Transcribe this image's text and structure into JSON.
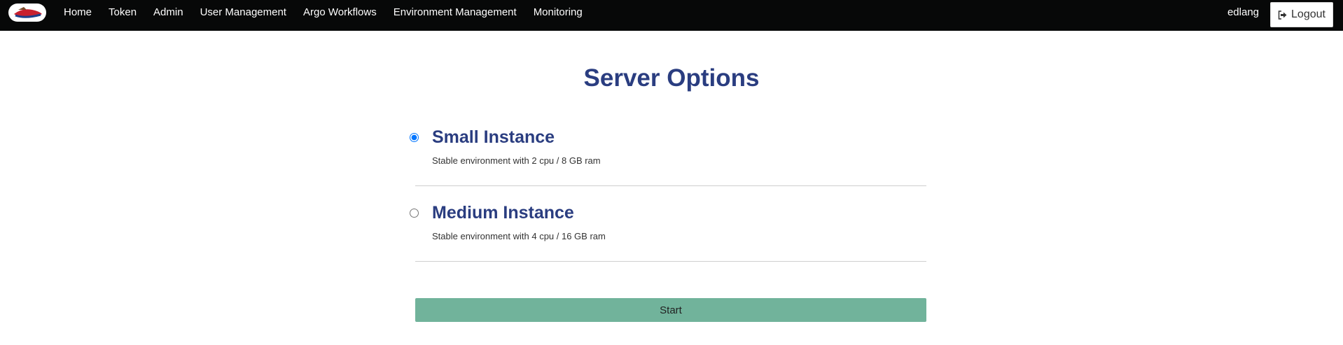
{
  "nav": {
    "logo_icon": "jupyterhub-logo-icon",
    "links": [
      "Home",
      "Token",
      "Admin",
      "User Management",
      "Argo Workflows",
      "Environment Management",
      "Monitoring"
    ],
    "username": "edlang",
    "logout_label": "Logout",
    "logout_icon": "sign-out-icon"
  },
  "page": {
    "title": "Server Options"
  },
  "options": [
    {
      "title": "Small Instance",
      "description": "Stable environment with 2 cpu / 8 GB ram",
      "selected": true
    },
    {
      "title": "Medium Instance",
      "description": "Stable environment with 4 cpu / 16 GB ram",
      "selected": false
    }
  ],
  "start_label": "Start",
  "colors": {
    "navbar": "#070808",
    "heading": "#2a3d80",
    "start_button": "#71b39b"
  }
}
